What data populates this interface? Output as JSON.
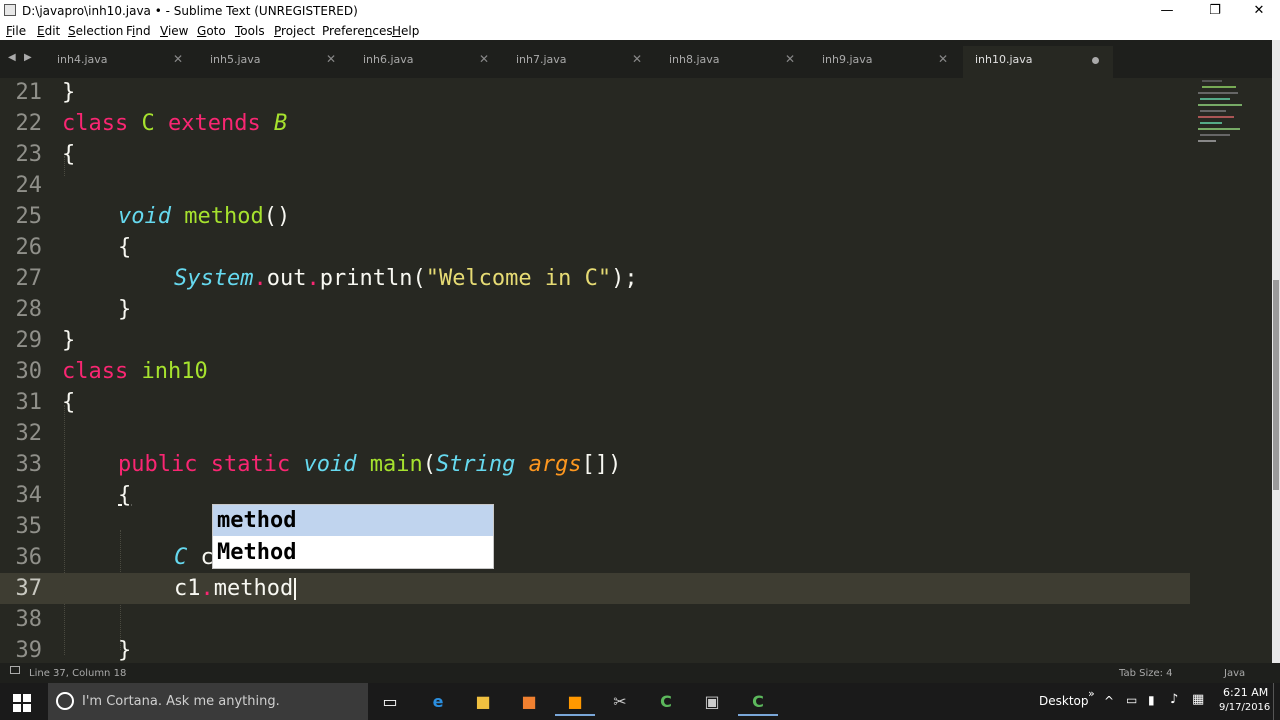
{
  "window": {
    "title": "D:\\javapro\\inh10.java • - Sublime Text (UNREGISTERED)",
    "controls": [
      "—",
      "❐",
      "✕"
    ]
  },
  "menu": {
    "file": {
      "key": "F",
      "rest": "ile"
    },
    "edit": {
      "key": "E",
      "rest": "dit"
    },
    "selection": {
      "key": "S",
      "rest": "election"
    },
    "find": {
      "pre": "F",
      "key": "i",
      "rest": "nd"
    },
    "view": {
      "key": "V",
      "rest": "iew"
    },
    "goto": {
      "key": "G",
      "rest": "oto"
    },
    "tools": {
      "key": "T",
      "rest": "ools"
    },
    "project": {
      "key": "P",
      "rest": "roject"
    },
    "preferences": {
      "pre": "Prefere",
      "key": "n",
      "rest": "ces"
    },
    "help": {
      "key": "H",
      "rest": "elp"
    }
  },
  "tabs": [
    {
      "label": "inh4.java"
    },
    {
      "label": "inh5.java"
    },
    {
      "label": "inh6.java"
    },
    {
      "label": "inh7.java"
    },
    {
      "label": "inh8.java"
    },
    {
      "label": "inh9.java"
    },
    {
      "label": "inh10.java"
    }
  ],
  "tab_nav": {
    "prev": "◀",
    "next": "▶",
    "close": "✕"
  },
  "code": {
    "l21": {
      "n": "21",
      "t1": "}"
    },
    "l22": {
      "n": "22",
      "kw1": "class",
      "name": "C",
      "kw2": "extends",
      "parent": "B"
    },
    "l23": {
      "n": "23",
      "t1": "{"
    },
    "l24": {
      "n": "24"
    },
    "l25": {
      "n": "25",
      "ty": "void",
      "name": "method",
      "rest": "()"
    },
    "l26": {
      "n": "26",
      "t1": "{"
    },
    "l27": {
      "n": "27",
      "cls": "System",
      "dot1": ".",
      "field": "out",
      "dot2": ".",
      "call": "println",
      "open": "(",
      "str": "\"Welcome in C\"",
      "close": ");"
    },
    "l28": {
      "n": "28",
      "t1": "}"
    },
    "l29": {
      "n": "29",
      "t1": "}"
    },
    "l30": {
      "n": "30",
      "kw1": "class",
      "name": "inh10"
    },
    "l31": {
      "n": "31",
      "t1": "{"
    },
    "l32": {
      "n": "32"
    },
    "l33": {
      "n": "33",
      "kw1": "public",
      "kw2": "static",
      "ty": "void",
      "name": "main",
      "open": "(",
      "ptype": "String",
      "arg": "args",
      "close": "[])"
    },
    "l34": {
      "n": "34",
      "t1": "{"
    },
    "l35": {
      "n": "35"
    },
    "l36": {
      "n": "36",
      "ty": "C",
      "rest": "c"
    },
    "l37": {
      "n": "37",
      "obj": "c1",
      "dot": ".",
      "name": "method"
    },
    "l38": {
      "n": "38"
    },
    "l39": {
      "n": "39",
      "t1": "}"
    }
  },
  "autocomplete": {
    "options": [
      {
        "label": "method"
      },
      {
        "label": "Method"
      }
    ]
  },
  "status": {
    "position": "Line 37, Column 18",
    "tab_size": "Tab Size: 4",
    "syntax": "Java"
  },
  "taskbar": {
    "search_placeholder": "I'm Cortana. Ask me anything.",
    "desktop": "Desktop",
    "time": "6:21 AM",
    "date": "9/17/2016",
    "tray_chevron": "»",
    "tray_up": "^"
  },
  "colors": {
    "background": "#272822",
    "keyword": "#f92672",
    "type": "#66d9ef",
    "entity": "#a6e22e",
    "string": "#e6db74",
    "argument": "#fd971f",
    "current_line": "#3e3d32"
  }
}
